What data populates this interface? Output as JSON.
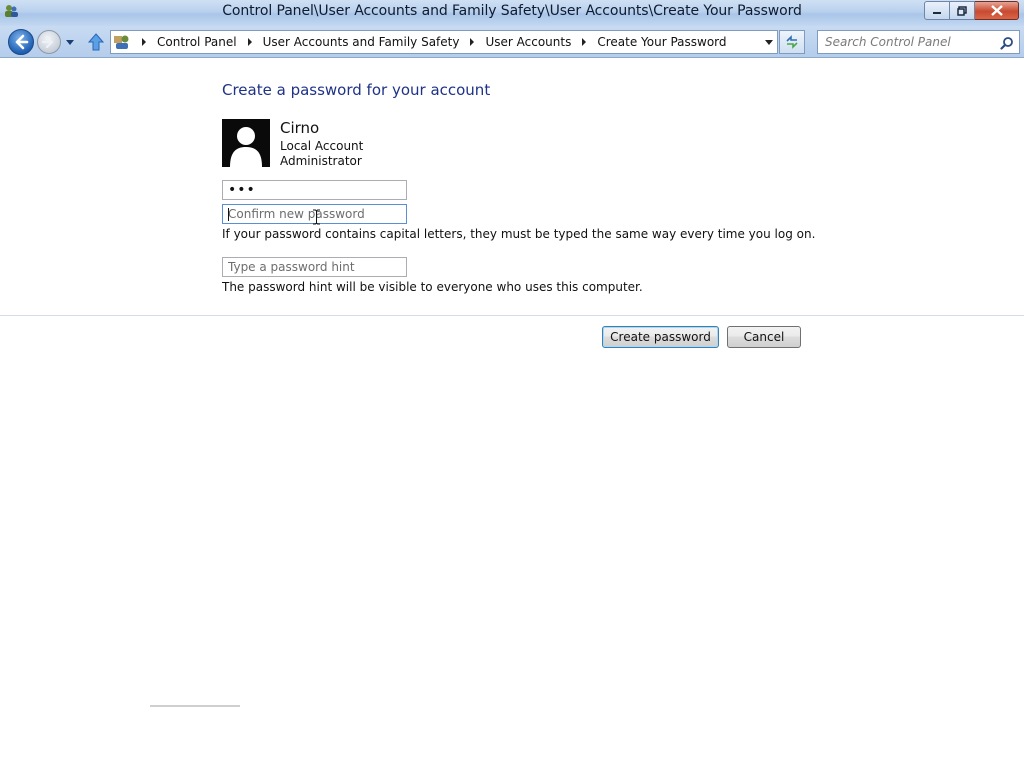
{
  "window": {
    "title": "Control Panel\\User Accounts and Family Safety\\User Accounts\\Create Your Password"
  },
  "navigation": {
    "breadcrumbs": [
      "Control Panel",
      "User Accounts and Family Safety",
      "User Accounts",
      "Create Your Password"
    ],
    "search_placeholder": "Search Control Panel"
  },
  "page": {
    "heading": "Create a password for your account",
    "user": {
      "name": "Cirno",
      "account_type": "Local Account",
      "role": "Administrator"
    },
    "form": {
      "new_password_value": "•••",
      "confirm_placeholder": "Confirm new password",
      "capital_letters_note": "If your password contains capital letters, they must be typed the same way every time you log on.",
      "hint_placeholder": "Type a password hint",
      "hint_note": "The password hint will be visible to everyone who uses this computer."
    },
    "buttons": {
      "create_label": "Create password",
      "cancel_label": "Cancel"
    }
  },
  "colors": {
    "heading": "#1e3287",
    "titlebar": "#b9d1ee",
    "primary_button_border": "#3c7fb1"
  }
}
